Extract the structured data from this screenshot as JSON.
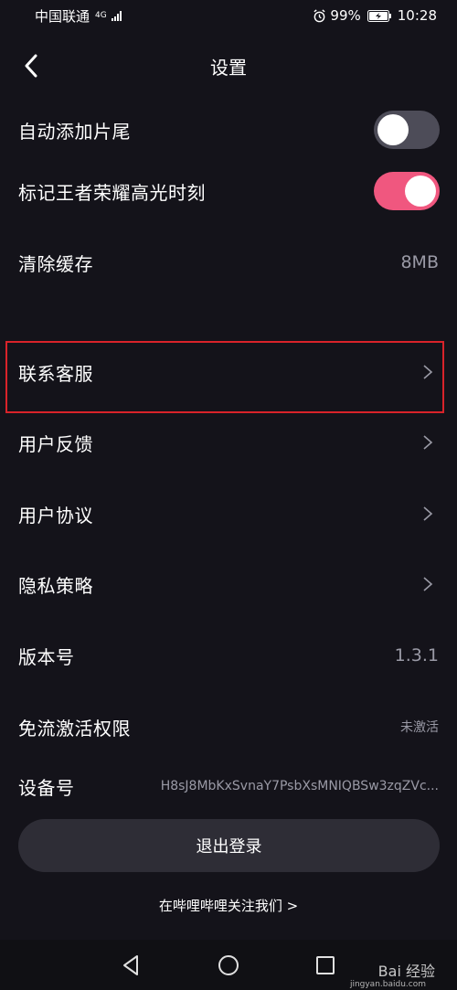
{
  "status_bar": {
    "carrier": "中国联通",
    "network": "4G",
    "battery": "99%",
    "time": "10:28"
  },
  "header": {
    "title": "设置",
    "back_icon": "chevron-left-icon"
  },
  "settings": {
    "auto_ending": {
      "label": "自动添加片尾",
      "enabled": false
    },
    "mark_highlights": {
      "label": "标记王者荣耀高光时刻",
      "enabled": true
    },
    "clear_cache": {
      "label": "清除缓存",
      "value": "8MB"
    },
    "contact_support": {
      "label": "联系客服"
    },
    "feedback": {
      "label": "用户反馈"
    },
    "user_agreement": {
      "label": "用户协议"
    },
    "privacy_policy": {
      "label": "隐私策略"
    },
    "version": {
      "label": "版本号",
      "value": "1.3.1"
    },
    "free_data": {
      "label": "免流激活权限",
      "value": "未激活"
    },
    "device_id": {
      "label": "设备号",
      "value": "H8sJ8MbKxSvnaY7PsbXsMNIQBSw3zqZVc..."
    }
  },
  "logout": {
    "label": "退出登录"
  },
  "follow_link": {
    "label": "在哔哩哔哩关注我们 >"
  },
  "watermark": {
    "text": "Bai 经验",
    "sub": "jingyan.baidu.com"
  },
  "colors": {
    "background": "#14131a",
    "toggle_on": "#f0577f",
    "toggle_off": "#4d4c58",
    "highlight": "#d9232a"
  }
}
